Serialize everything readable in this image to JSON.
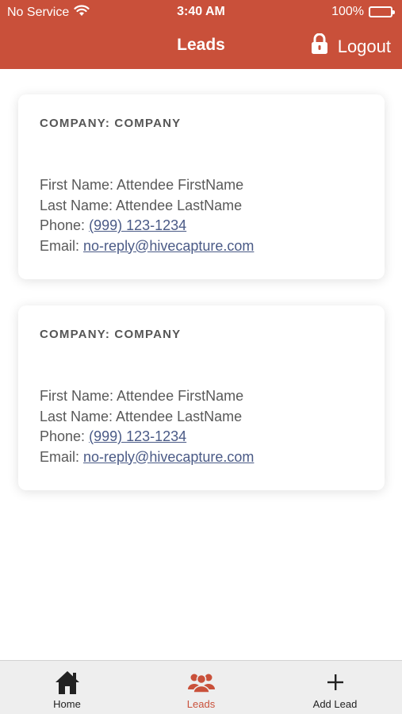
{
  "status_bar": {
    "carrier": "No Service",
    "time": "3:40 AM",
    "battery": "100%"
  },
  "header": {
    "title": "Leads",
    "logout_label": "Logout",
    "background": "#c9503a"
  },
  "leads": [
    {
      "company": "COMPANY: COMPANY",
      "first_name": "First Name: Attendee FirstName",
      "last_name": "Last Name: Attendee LastName",
      "phone_label": "Phone:",
      "phone": "(999) 123-1234",
      "email_label": "Email:",
      "email": "no-reply@hivecapture.com"
    },
    {
      "company": "COMPANY: COMPANY",
      "first_name": "First Name: Attendee FirstName",
      "last_name": "Last Name: Attendee LastName",
      "phone_label": "Phone:",
      "phone": "(999) 123-1234",
      "email_label": "Email:",
      "email": "no-reply@hivecapture.com"
    }
  ],
  "tabs": [
    {
      "label": "Home",
      "icon": "home-icon"
    },
    {
      "label": "Leads",
      "icon": "people-icon",
      "active": true
    },
    {
      "label": "Add Lead",
      "icon": "plus-icon"
    }
  ],
  "colors": {
    "accent": "#c9503a",
    "link": "#4a5a86",
    "text": "#595959"
  }
}
